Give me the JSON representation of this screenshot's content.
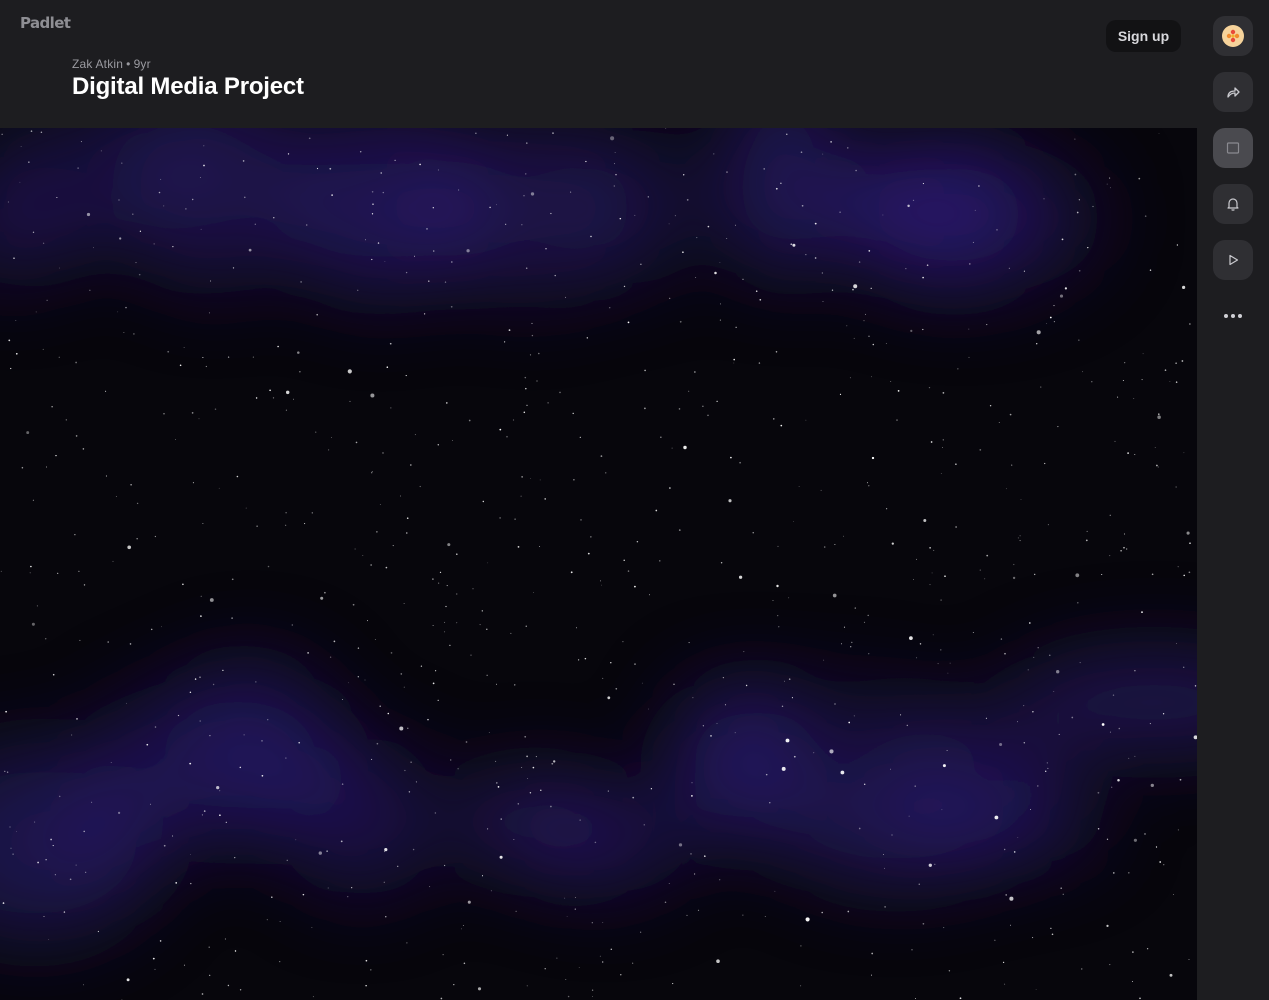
{
  "brand": {
    "logo_text": "Padlet"
  },
  "header": {
    "author": "Zak Atkin",
    "separator": "•",
    "age": "9yr",
    "title": "Digital Media Project",
    "signup_label": "Sign up"
  },
  "rail": {
    "buttons": [
      {
        "name": "avatar",
        "icon": "flower-avatar-icon"
      },
      {
        "name": "share",
        "icon": "share-icon"
      },
      {
        "name": "slideshow",
        "icon": "square-icon"
      },
      {
        "name": "notifications",
        "icon": "bell-icon"
      },
      {
        "name": "play",
        "icon": "play-icon"
      },
      {
        "name": "more",
        "icon": "more-dots-icon"
      }
    ]
  },
  "wallpaper": {
    "theme": "starry-night",
    "colors": {
      "base": "#07060c",
      "nebula": "#2a1a6e",
      "star": "#ffffff"
    }
  },
  "colors": {
    "header_bg": "#1d1d20",
    "button_bg": "#2f2f33",
    "active_button_bg": "#4a4a4f",
    "title": "#ffffff",
    "muted": "#9a9aa0"
  }
}
